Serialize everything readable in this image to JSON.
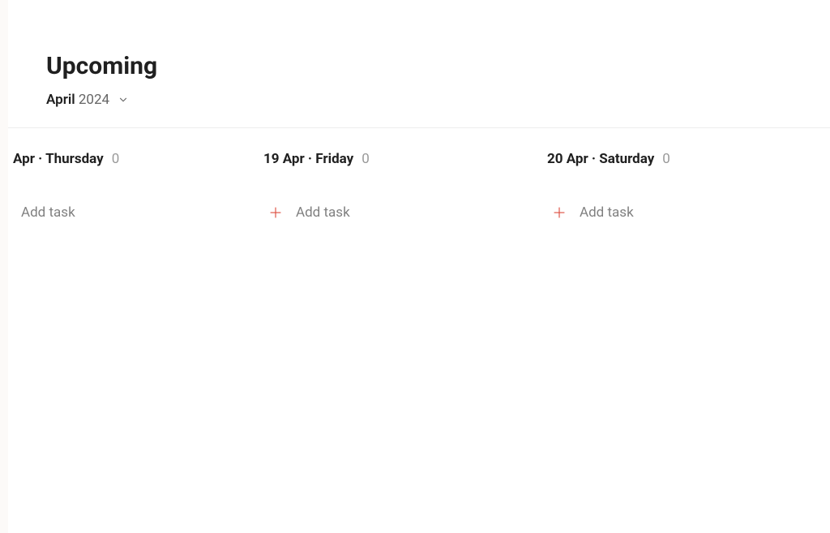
{
  "header": {
    "title": "Upcoming",
    "month": "April",
    "year": "2024"
  },
  "columns": [
    {
      "label": "Apr · Thursday",
      "count": "0",
      "add_label": "Add task",
      "show_plus": false
    },
    {
      "label": "19 Apr · Friday",
      "count": "0",
      "add_label": "Add task",
      "show_plus": true
    },
    {
      "label": "20 Apr · Saturday",
      "count": "0",
      "add_label": "Add task",
      "show_plus": true
    }
  ]
}
